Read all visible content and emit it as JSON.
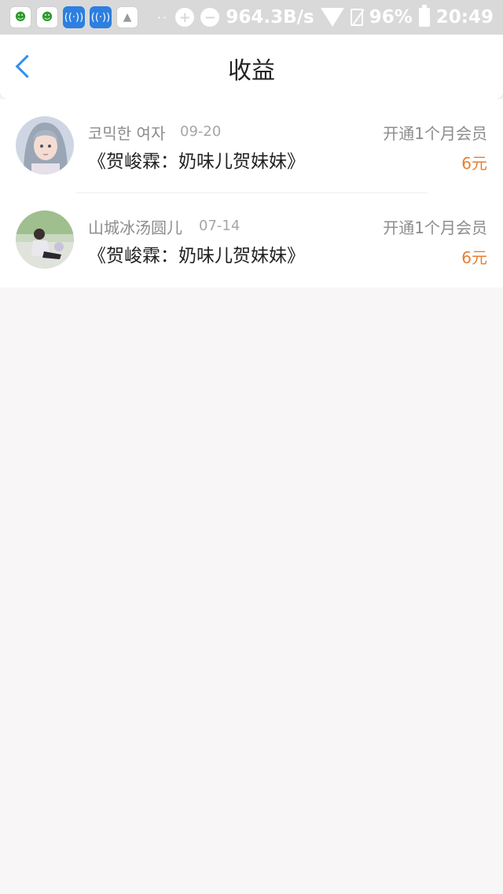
{
  "status_bar": {
    "net_speed": "964.3B/s",
    "battery": "96%",
    "time": "20:49",
    "dots": "··"
  },
  "header": {
    "title": "收益"
  },
  "colors": {
    "accent_blue": "#2f8ff0",
    "amount_orange": "#e57f32"
  },
  "earnings": [
    {
      "name": "코믹한 여자",
      "date": "09-20",
      "book": "《贺峻霖：奶味儿贺妹妹》",
      "type": "开通1个月会员",
      "amount": "6元"
    },
    {
      "name": "山城冰汤圆儿",
      "date": "07-14",
      "book": "《贺峻霖：奶味儿贺妹妹》",
      "type": "开通1个月会员",
      "amount": "6元"
    }
  ]
}
